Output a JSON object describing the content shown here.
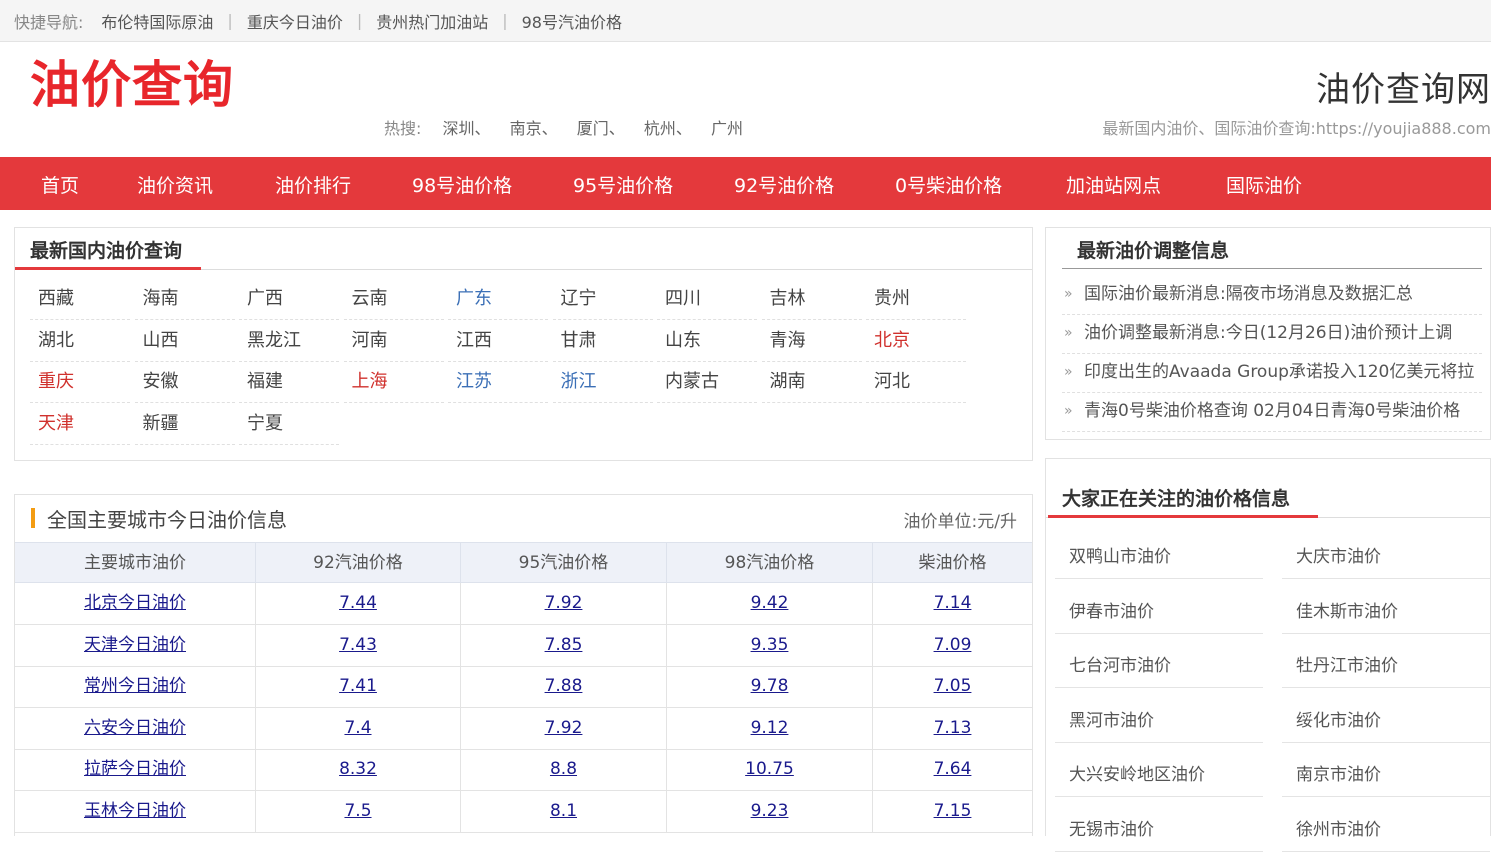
{
  "topnav": {
    "label": "快捷导航:",
    "links": [
      "布伦特国际原油",
      "重庆今日油价",
      "贵州热门加油站",
      "98号汽油价格"
    ]
  },
  "header": {
    "logo": "油价查询",
    "hot_label": "热搜:",
    "hot": [
      "深圳、",
      "南京、",
      "厦门、",
      "杭州、",
      "广州"
    ],
    "site_title": "油价查询网",
    "site_sub": "最新国内油价、国际油价查询:https://youjia888.com"
  },
  "nav": [
    "首页",
    "油价资讯",
    "油价排行",
    "98号油价格",
    "95号油价格",
    "92号油价格",
    "0号柴油价格",
    "加油站网点",
    "国际油价"
  ],
  "provinces": {
    "title": "最新国内油价查询",
    "items": [
      {
        "name": "西藏",
        "color": "#444444"
      },
      {
        "name": "海南",
        "color": "#444444"
      },
      {
        "name": "广西",
        "color": "#444444"
      },
      {
        "name": "云南",
        "color": "#444444"
      },
      {
        "name": "广东",
        "color": "#3b6fb6"
      },
      {
        "name": "辽宁",
        "color": "#444444"
      },
      {
        "name": "四川",
        "color": "#444444"
      },
      {
        "name": "吉林",
        "color": "#444444"
      },
      {
        "name": "贵州",
        "color": "#444444"
      },
      {
        "name": "湖北",
        "color": "#444444"
      },
      {
        "name": "山西",
        "color": "#444444"
      },
      {
        "name": "黑龙江",
        "color": "#444444"
      },
      {
        "name": "河南",
        "color": "#444444"
      },
      {
        "name": "江西",
        "color": "#444444"
      },
      {
        "name": "甘肃",
        "color": "#444444"
      },
      {
        "name": "山东",
        "color": "#444444"
      },
      {
        "name": "青海",
        "color": "#444444"
      },
      {
        "name": "北京",
        "color": "#d0312d"
      },
      {
        "name": "重庆",
        "color": "#d0312d"
      },
      {
        "name": "安徽",
        "color": "#444444"
      },
      {
        "name": "福建",
        "color": "#444444"
      },
      {
        "name": "上海",
        "color": "#d0312d"
      },
      {
        "name": "江苏",
        "color": "#3b6fb6"
      },
      {
        "name": "浙江",
        "color": "#3b6fb6"
      },
      {
        "name": "内蒙古",
        "color": "#444444"
      },
      {
        "name": "湖南",
        "color": "#444444"
      },
      {
        "name": "河北",
        "color": "#444444"
      },
      {
        "name": "天津",
        "color": "#d0312d"
      },
      {
        "name": "新疆",
        "color": "#444444"
      },
      {
        "name": "宁夏",
        "color": "#444444"
      }
    ]
  },
  "news": {
    "title": "最新油价调整信息",
    "items": [
      "国际油价最新消息:隔夜市场消息及数据汇总",
      "油价调整最新消息:今日(12月26日)油价预计上调",
      "印度出生的Avaada Group承诺投入120亿美元将拉",
      "青海0号柴油价格查询 02月04日青海0号柴油价格"
    ]
  },
  "price_table": {
    "title": "全国主要城市今日油价信息",
    "unit": "油价单位:元/升",
    "headers": [
      "主要城市油价",
      "92汽油价格",
      "95汽油价格",
      "98汽油价格",
      "柴油价格"
    ],
    "rows": [
      [
        "北京今日油价",
        "7.44",
        "7.92",
        "9.42",
        "7.14"
      ],
      [
        "天津今日油价",
        "7.43",
        "7.85",
        "9.35",
        "7.09"
      ],
      [
        "常州今日油价",
        "7.41",
        "7.88",
        "9.78",
        "7.05"
      ],
      [
        "六安今日油价",
        "7.4",
        "7.92",
        "9.12",
        "7.13"
      ],
      [
        "拉萨今日油价",
        "8.32",
        "8.8",
        "10.75",
        "7.64"
      ],
      [
        "玉林今日油价",
        "7.5",
        "8.1",
        "9.23",
        "7.15"
      ]
    ]
  },
  "attention": {
    "title": "大家正在关注的油价格信息",
    "items": [
      "双鸭山市油价",
      "大庆市油价",
      "伊春市油价",
      "佳木斯市油价",
      "七台河市油价",
      "牡丹江市油价",
      "黑河市油价",
      "绥化市油价",
      "大兴安岭地区油价",
      "南京市油价",
      "无锡市油价",
      "徐州市油价"
    ]
  },
  "colors": {
    "brand_red": "#e4393c",
    "link_blue": "#1a1a8c"
  }
}
